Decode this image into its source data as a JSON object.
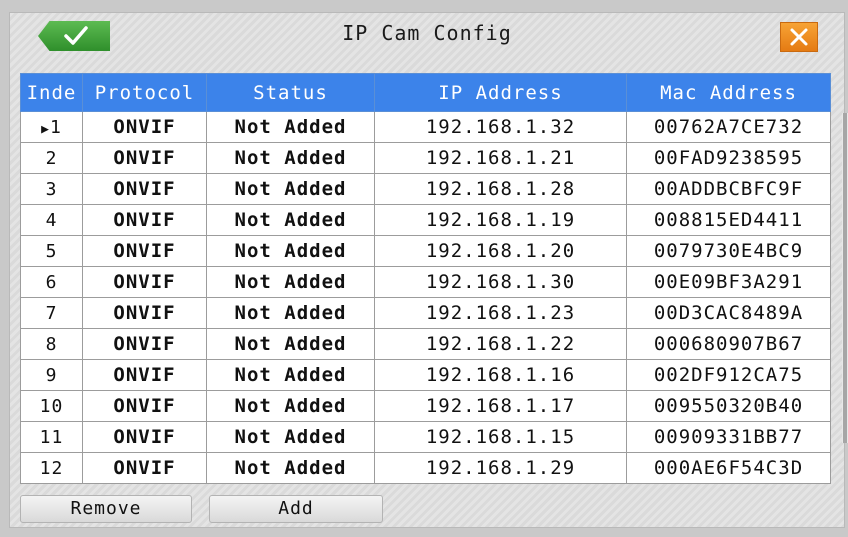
{
  "window": {
    "title": "IP Cam Config",
    "ok_icon": "checkmark-icon",
    "close_icon": "close-x-icon",
    "ok_color": "#3aa23a",
    "close_color": "#f0901e"
  },
  "table": {
    "headers": [
      "Inde",
      "Protocol",
      "Status",
      "IP Address",
      "Mac Address"
    ],
    "header_color": "#3c83ea",
    "selected_row_marker": "▶",
    "rows": [
      {
        "index": "1",
        "protocol": "ONVIF",
        "status": "Not Added",
        "ip": "192.168.1.32",
        "mac": "00762A7CE732"
      },
      {
        "index": "2",
        "protocol": "ONVIF",
        "status": "Not Added",
        "ip": "192.168.1.21",
        "mac": "00FAD9238595"
      },
      {
        "index": "3",
        "protocol": "ONVIF",
        "status": "Not Added",
        "ip": "192.168.1.28",
        "mac": "00ADDBCBFC9F"
      },
      {
        "index": "4",
        "protocol": "ONVIF",
        "status": "Not Added",
        "ip": "192.168.1.19",
        "mac": "008815ED4411"
      },
      {
        "index": "5",
        "protocol": "ONVIF",
        "status": "Not Added",
        "ip": "192.168.1.20",
        "mac": "0079730E4BC9"
      },
      {
        "index": "6",
        "protocol": "ONVIF",
        "status": "Not Added",
        "ip": "192.168.1.30",
        "mac": "00E09BF3A291"
      },
      {
        "index": "7",
        "protocol": "ONVIF",
        "status": "Not Added",
        "ip": "192.168.1.23",
        "mac": "00D3CAC8489A"
      },
      {
        "index": "8",
        "protocol": "ONVIF",
        "status": "Not Added",
        "ip": "192.168.1.22",
        "mac": "000680907B67"
      },
      {
        "index": "9",
        "protocol": "ONVIF",
        "status": "Not Added",
        "ip": "192.168.1.16",
        "mac": "002DF912CA75"
      },
      {
        "index": "10",
        "protocol": "ONVIF",
        "status": "Not Added",
        "ip": "192.168.1.17",
        "mac": "009550320B40"
      },
      {
        "index": "11",
        "protocol": "ONVIF",
        "status": "Not Added",
        "ip": "192.168.1.15",
        "mac": "00909331BB77"
      },
      {
        "index": "12",
        "protocol": "ONVIF",
        "status": "Not Added",
        "ip": "192.168.1.29",
        "mac": "000AE6F54C3D"
      }
    ]
  },
  "buttons": {
    "remove_label": "Remove",
    "add_label": "Add"
  }
}
